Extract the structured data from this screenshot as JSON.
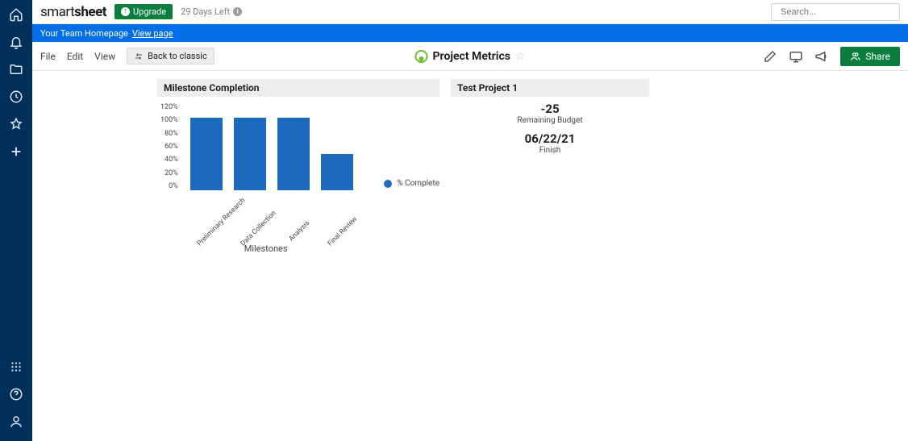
{
  "brand": {
    "part1": "smart",
    "part2": "sheet"
  },
  "upgrade_label": "Upgrade",
  "trial_text": "29 Days Left",
  "search": {
    "placeholder": "Search..."
  },
  "banner": {
    "text": "Your Team Homepage",
    "link": "View page"
  },
  "menu": {
    "file": "File",
    "edit": "Edit",
    "view": "View",
    "back": "Back to classic"
  },
  "page_title": "Project Metrics",
  "share_label": "Share",
  "widget1_title": "Milestone Completion",
  "widget2_title": "Test Project 1",
  "metrics": {
    "budget_value": "-25",
    "budget_label": "Remaining Budget",
    "finish_value": "06/22/21",
    "finish_label": "Finish"
  },
  "chart_data": {
    "type": "bar",
    "title": "Milestone Completion",
    "series_name": "% Complete",
    "categories": [
      "Preliminary Research",
      "Data Collection",
      "Analysis",
      "Final Review"
    ],
    "values": [
      100,
      100,
      100,
      50
    ],
    "ylim": [
      0,
      120
    ],
    "yticks": [
      "120%",
      "100%",
      "80%",
      "60%",
      "40%",
      "20%",
      "0%"
    ],
    "xlabel": "Milestones",
    "ylabel": ""
  }
}
